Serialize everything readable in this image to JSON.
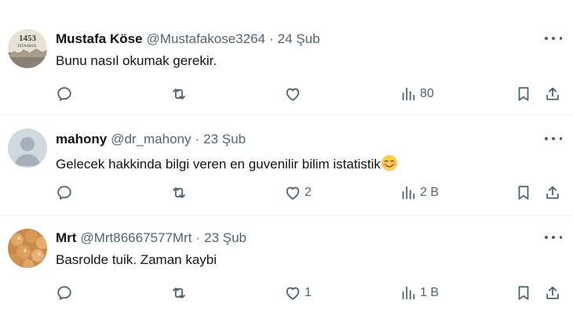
{
  "tweets": [
    {
      "name": "Mustafa Köse",
      "handle": "@Mustafakose3264",
      "separator": "·",
      "date": "24 Şub",
      "text": "Bunu nasıl okumak gerekir.",
      "avatar_text": "1453 İSTANBUL",
      "replies": "",
      "retweets": "",
      "likes": "",
      "views": "80"
    },
    {
      "name": "mahony",
      "handle": "@dr_mahony",
      "separator": "·",
      "date": "23 Şub",
      "text": "Gelecek hakkinda bilgi veren en guvenilir bilim istatistik",
      "emoji": "smiling-face-icon",
      "replies": "",
      "retweets": "",
      "likes": "2",
      "views": "2 B"
    },
    {
      "name": "Mrt",
      "handle": "@Mrt86667577Mrt",
      "separator": "·",
      "date": "23 Şub",
      "text": "Basrolde tuik. Zaman kaybi",
      "replies": "",
      "retweets": "",
      "likes": "1",
      "views": "1 B"
    }
  ],
  "colors": {
    "secondary_text": "#536471",
    "primary_text": "#0f1419",
    "divider": "#eff3f4"
  }
}
